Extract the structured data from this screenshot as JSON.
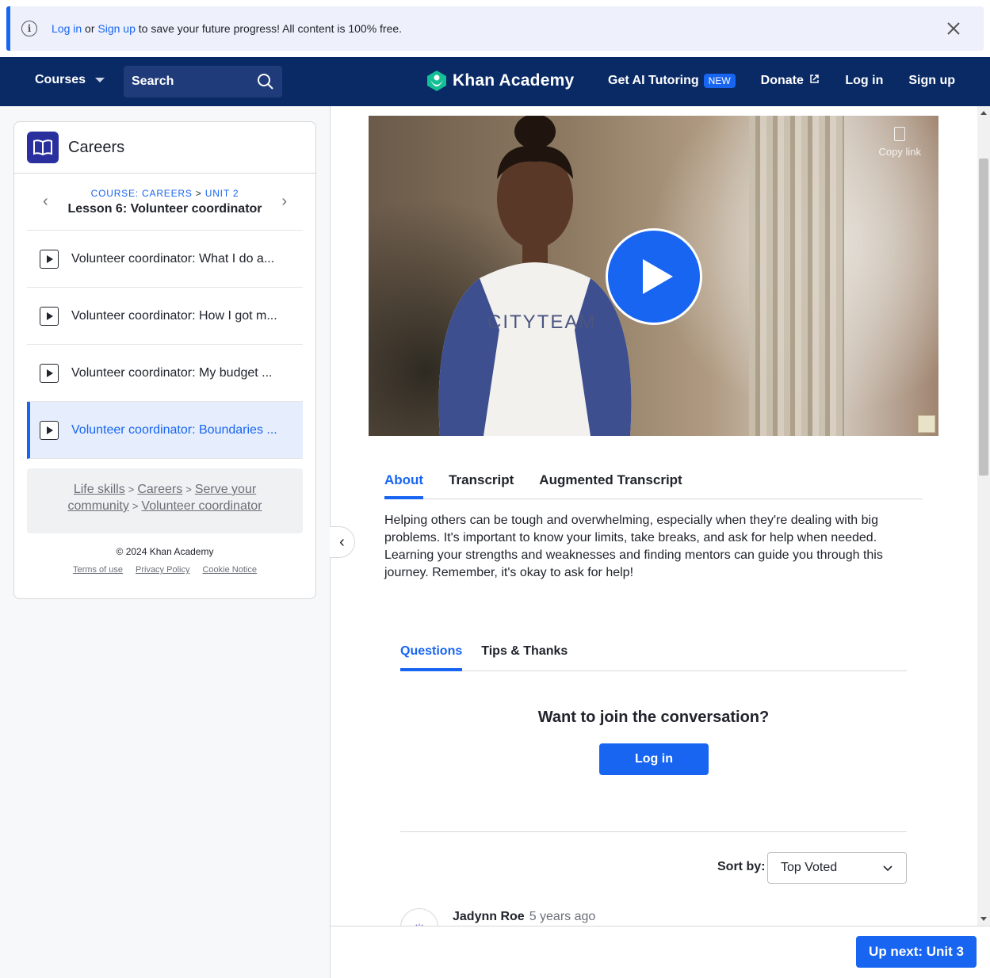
{
  "banner": {
    "login_link": "Log in",
    "or_text": " or ",
    "signup_link": "Sign up",
    "message": " to save your future progress! All content is 100% free."
  },
  "nav": {
    "courses": "Courses",
    "search_placeholder": "Search",
    "logo": "Khan Academy",
    "ai_tutoring": "Get AI Tutoring",
    "new_badge": "NEW",
    "donate": "Donate",
    "login": "Log in",
    "signup": "Sign up"
  },
  "sidebar": {
    "course_title": "Careers",
    "crumb_course": "COURSE: CAREERS",
    "crumb_sep": " > ",
    "crumb_unit": "UNIT 2",
    "lesson_title": "Lesson 6: Volunteer coordinator",
    "items": [
      {
        "label": "Volunteer coordinator: What I do a..."
      },
      {
        "label": "Volunteer coordinator: How I got m..."
      },
      {
        "label": "Volunteer coordinator: My budget ..."
      },
      {
        "label": "Volunteer coordinator: Boundaries ..."
      }
    ],
    "path": {
      "life_skills": "Life skills",
      "careers": "Careers",
      "serve": "Serve your community",
      "volunteer": "Volunteer coordinator",
      "sep": ">"
    },
    "copyright": "© 2024 Khan Academy",
    "terms": "Terms of use",
    "privacy": "Privacy Policy",
    "cookie": "Cookie Notice"
  },
  "video": {
    "copy_link": "Copy link",
    "shirt_text": "CITYTEAM"
  },
  "tabs": [
    "About",
    "Transcript",
    "Augmented Transcript"
  ],
  "about_text": "Helping others can be tough and overwhelming, especially when they're dealing with big problems. It's important to know your limits, take breaks, and ask for help when needed. Learning your strengths and weaknesses and finding mentors can guide you through this journey. Remember, it's okay to ask for help!",
  "discussion": {
    "tabs": [
      "Questions",
      "Tips & Thanks"
    ],
    "join_prompt": "Want to join the conversation?",
    "login_button": "Log in",
    "sort_label": "Sort by:",
    "sort_value": "Top Voted",
    "comment_author": "Jadynn Roe",
    "comment_time": "5 years ago"
  },
  "up_next": "Up next: Unit 3",
  "colors": {
    "accent": "#1865f2",
    "nav_bg": "#0a2a66",
    "logo_green": "#14bf96"
  }
}
